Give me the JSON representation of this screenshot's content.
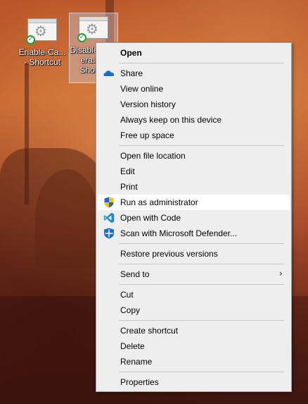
{
  "desktop": {
    "icons": [
      {
        "label_line1": "Enable-Ca...",
        "label_line2": "- Shortcut",
        "icon": "gear-shortcut-icon",
        "status_icon": "synced-check-icon"
      },
      {
        "label_line1": "Disable",
        "label_line2": "era.b",
        "label_line3": "Shor",
        "icon": "gear-shortcut-icon",
        "status_icon": "synced-check-icon"
      }
    ]
  },
  "context_menu": {
    "items": {
      "open": "Open",
      "share": "Share",
      "view_online": "View online",
      "version_history": "Version history",
      "always_keep": "Always keep on this device",
      "free_up_space": "Free up space",
      "open_file_location": "Open file location",
      "edit": "Edit",
      "print": "Print",
      "run_as_admin": "Run as administrator",
      "open_with_code": "Open with Code",
      "scan_defender": "Scan with Microsoft Defender...",
      "restore_previous": "Restore previous versions",
      "send_to": "Send to",
      "cut": "Cut",
      "copy": "Copy",
      "create_shortcut": "Create shortcut",
      "delete": "Delete",
      "rename": "Rename",
      "properties": "Properties"
    },
    "highlighted_item": "run_as_admin",
    "icons": {
      "share": "onedrive-cloud-icon",
      "run_as_admin": "uac-shield-icon",
      "open_with_code": "vscode-icon",
      "scan_defender": "defender-shield-icon",
      "send_to": "chevron-right-icon"
    },
    "colors": {
      "menu_bg": "#eeeeee",
      "highlight_bg": "#ffffff",
      "separator": "#c8c8c8",
      "onedrive_blue": "#0f6fd4",
      "vscode_blue": "#1a8ad4"
    }
  }
}
